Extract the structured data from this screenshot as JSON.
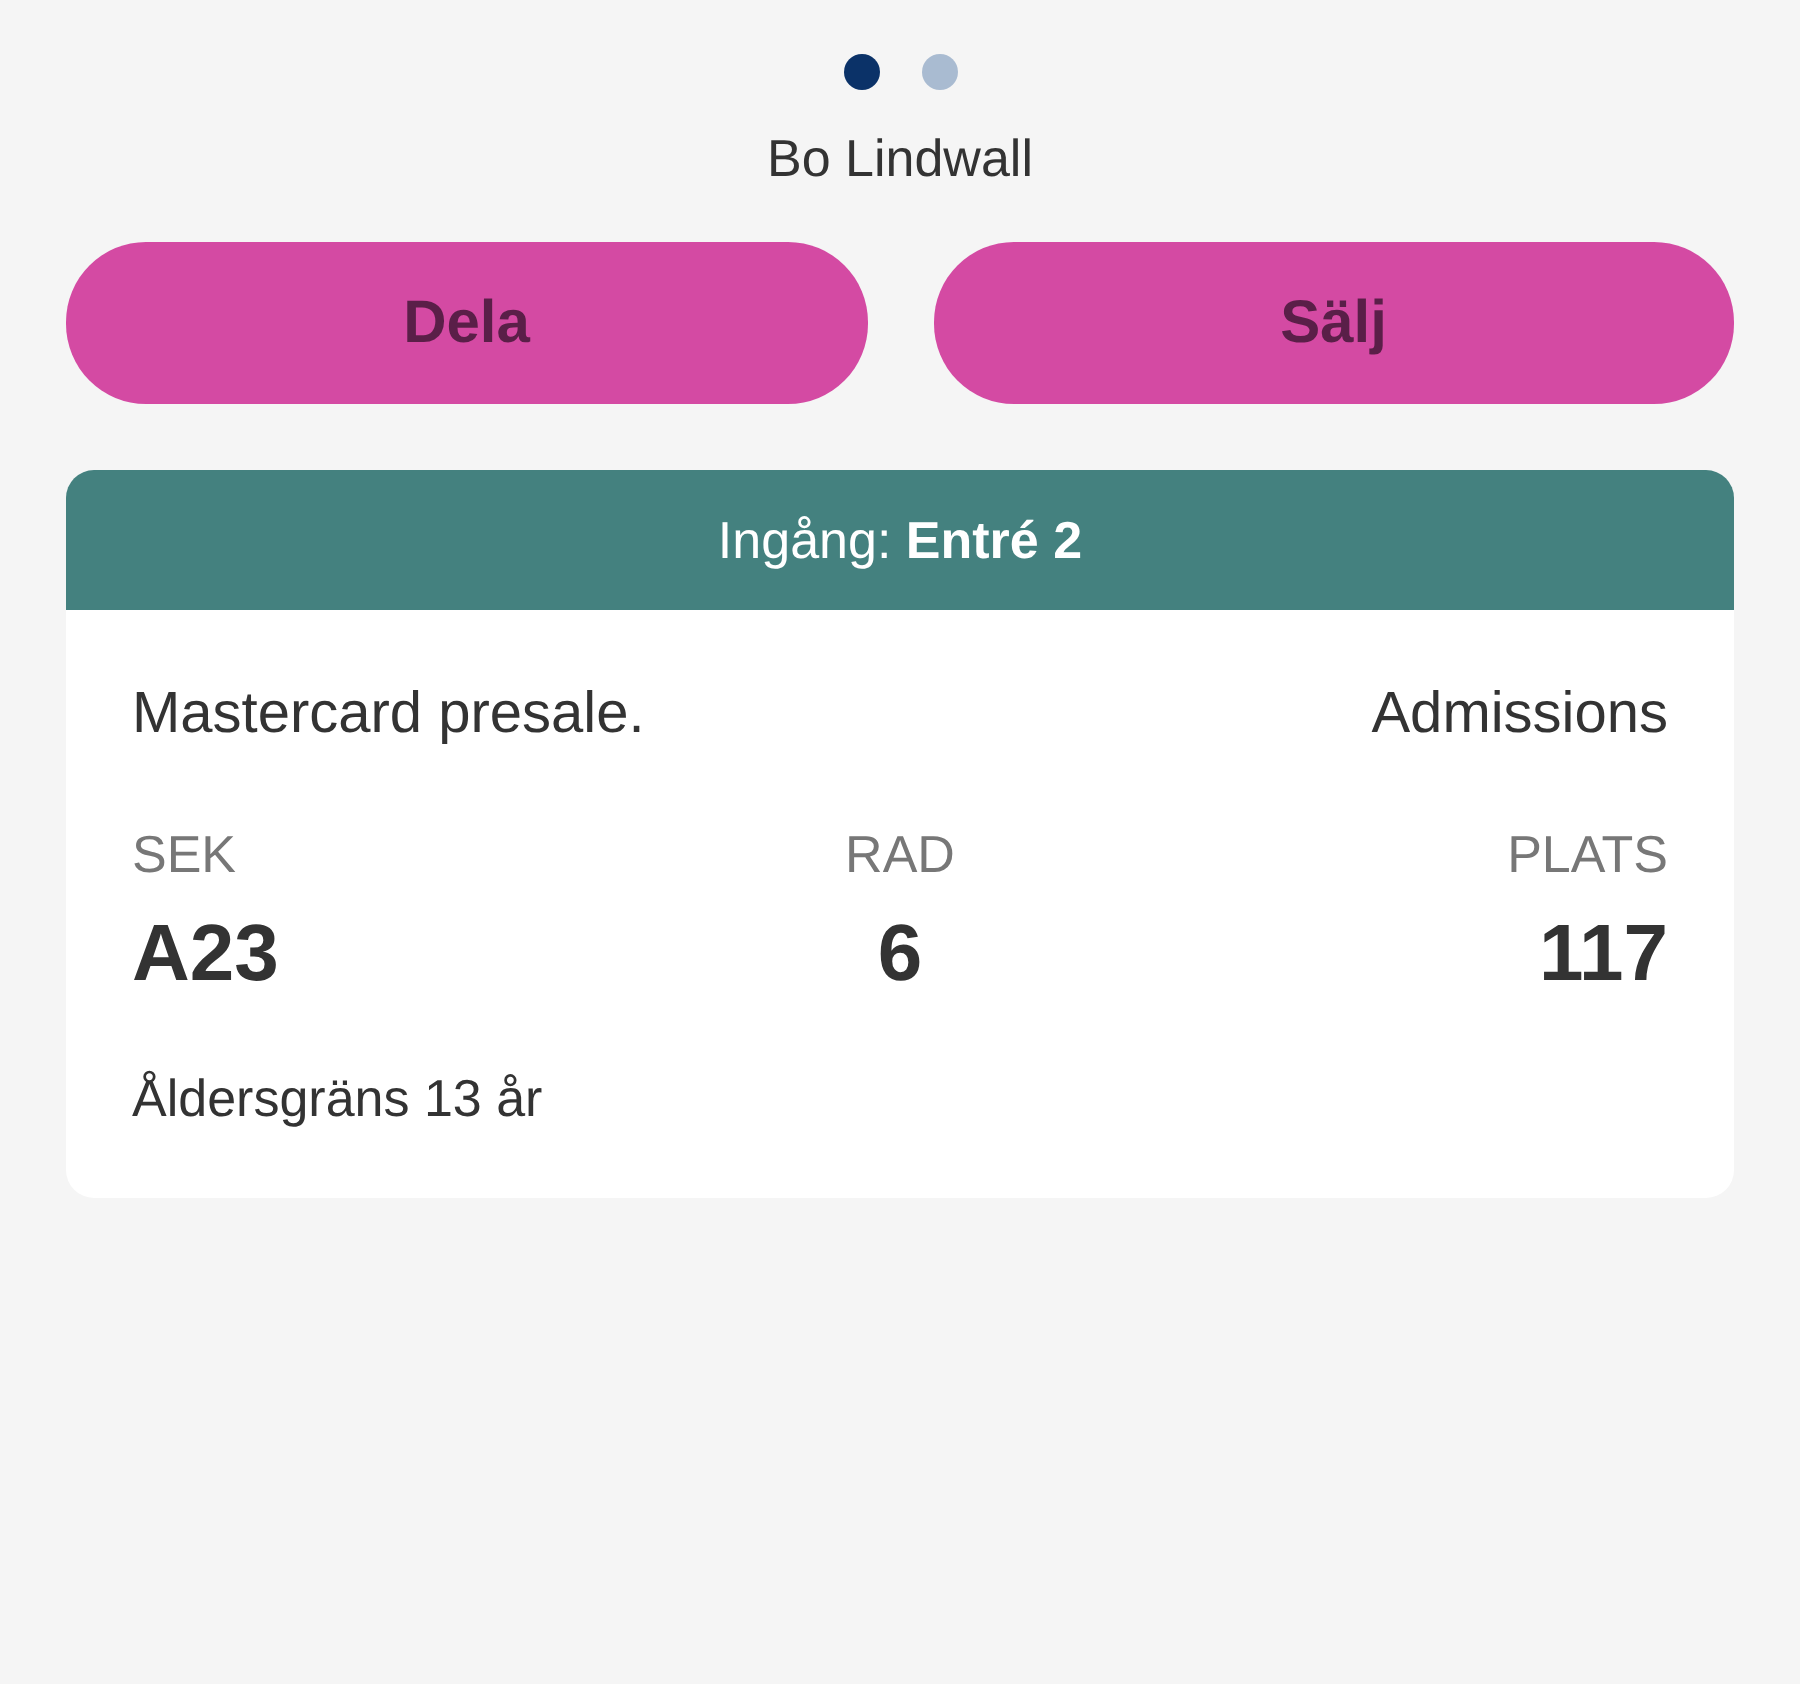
{
  "pager": [
    {
      "selected": true
    },
    {
      "selected": false
    }
  ],
  "holder": "Bo Lindwall",
  "buttons": [
    {
      "label": "Dela"
    },
    {
      "label": "Sälj"
    }
  ],
  "ticket": {
    "entrance": "Ingång: **Entré 2**",
    "offer": "Mastercard presale.",
    "type": "Admissions",
    "fields": [
      {
        "label": "SEK",
        "value": "A23"
      },
      {
        "label": "RAD",
        "value": "6"
      },
      {
        "label": "PLATS",
        "value": "117"
      }
    ],
    "age_limit": "Åldersgräns 13 år"
  }
}
